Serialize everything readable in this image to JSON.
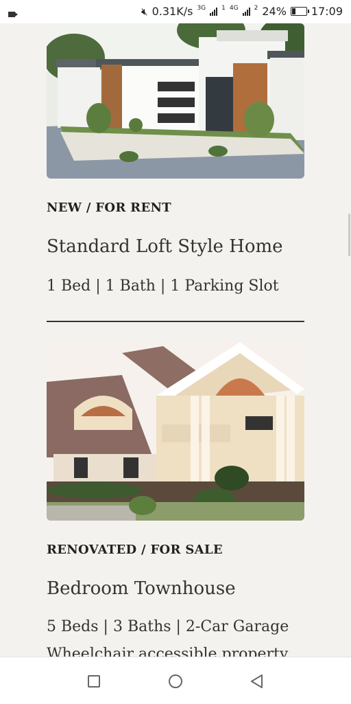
{
  "status_bar": {
    "speed": "0.31K/s",
    "net1": "3G",
    "net2": "4G",
    "sub1": "1",
    "sub2": "2",
    "battery": "24%",
    "time": "17:09"
  },
  "listings": [
    {
      "tag": "NEW / FOR RENT",
      "title": "Standard Loft Style Home",
      "specs": "1 Bed | 1 Bath | 1 Parking Slot",
      "image": "modern-bungalow-photo"
    },
    {
      "tag": "RENOVATED / FOR SALE",
      "title": "Bedroom Townhouse",
      "specs": "5  Beds | 3 Baths | 2-Car Garage",
      "extra": "Wheelchair accessible property",
      "image": "two-storey-townhouse-photo"
    }
  ],
  "nav": {
    "recent": "square-icon",
    "home": "circle-icon",
    "back": "triangle-back-icon"
  }
}
